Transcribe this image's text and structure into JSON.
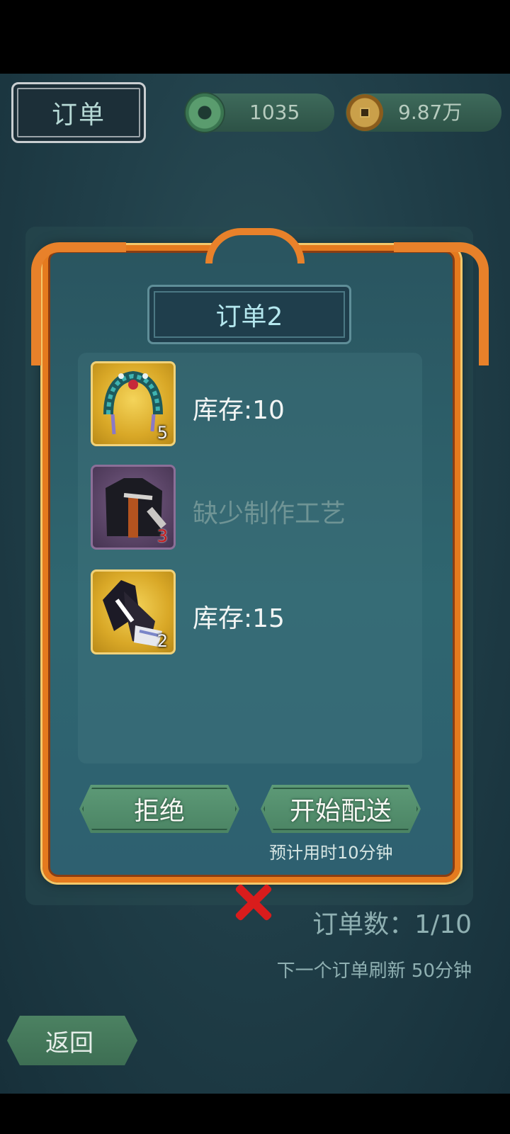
{
  "header": {
    "title": "订单",
    "jade_amount": "1035",
    "coin_amount": "9.87万"
  },
  "panel": {
    "order_title": "订单2",
    "items": [
      {
        "count": "5",
        "status": "库存:10",
        "icon": "phoenix-crown-icon"
      },
      {
        "count": "3",
        "status": "缺少制作工艺",
        "icon": "dark-robe-icon"
      },
      {
        "count": "2",
        "status": "库存:15",
        "icon": "sleeved-robe-icon"
      }
    ],
    "reject_label": "拒绝",
    "deliver_label": "开始配送",
    "estimate_text": "预计用时10分钟"
  },
  "footer": {
    "order_count": "订单数：1/10",
    "refresh_text": "下一个订单刷新 50分钟",
    "back_label": "返回"
  },
  "colors": {
    "frame": "#e57a1e",
    "button": "#5d9a77",
    "close": "#d91c1c"
  }
}
